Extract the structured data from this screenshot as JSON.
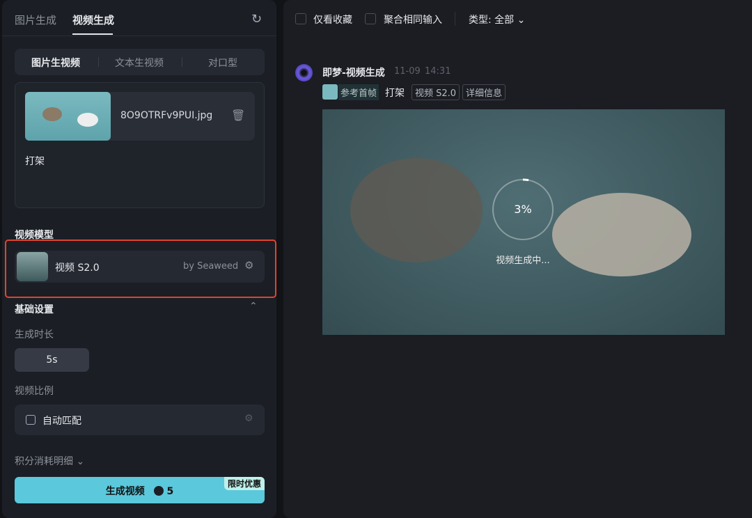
{
  "left": {
    "tabs": [
      {
        "label": "图片生成",
        "active": false
      },
      {
        "label": "视频生成",
        "active": true
      }
    ],
    "refresh_icon": "refresh-icon",
    "modes": [
      {
        "label": "图片生视频",
        "active": true
      },
      {
        "label": "文本生视频",
        "active": false
      },
      {
        "label": "对口型",
        "active": false
      }
    ],
    "upload": {
      "filename": "8O9OTRFv9PUI.jpg",
      "prompt": "打架"
    },
    "model_section": "视频模型",
    "model": {
      "name": "视频 S2.0",
      "by": "by Seaweed"
    },
    "basic_settings": "基础设置",
    "duration_label": "生成时长",
    "duration": "5s",
    "ratio_label": "视频比例",
    "ratio": "自动匹配",
    "points_detail": "积分消耗明细",
    "generate": {
      "label": "生成视频",
      "cost": "5",
      "promo": "限时优惠"
    },
    "accent": "#5bc8dc",
    "highlight": "#e0442f"
  },
  "right": {
    "filters": {
      "favorites": "仅看收藏",
      "merge": "聚合相同输入",
      "type": "类型: 全部"
    },
    "item": {
      "title": "即梦-视频生成",
      "date": "11-09",
      "time": "14:31",
      "ref": "参考首帧",
      "prompt": "打架",
      "model_tag": "视频 S2.0",
      "detail_tag": "详细信息",
      "progress_text": "3%",
      "progress": 3,
      "status": "视频生成中..."
    }
  }
}
